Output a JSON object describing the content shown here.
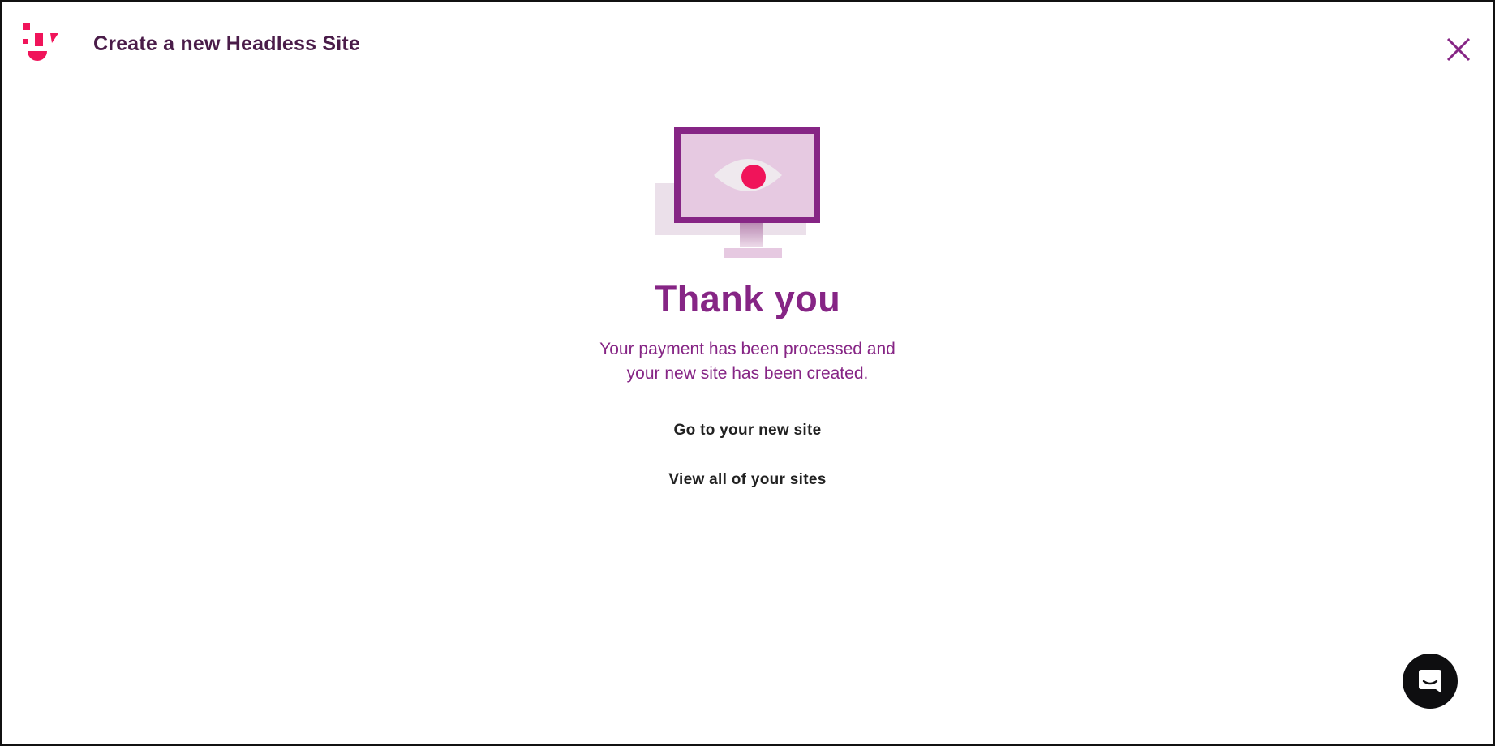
{
  "header": {
    "title": "Create a new Headless Site",
    "logo_icon": "brand-logo-icon",
    "close_icon": "close-icon"
  },
  "main": {
    "illustration_icon": "monitor-eye-icon",
    "heading": "Thank you",
    "message_line1": "Your payment has been processed and",
    "message_line2": "your new site has been created.",
    "links": [
      {
        "label": "Go to your new site"
      },
      {
        "label": "View all of your sites"
      }
    ]
  },
  "chat": {
    "icon": "chat-icon"
  },
  "colors": {
    "brand_pink": "#f0145a",
    "brand_purple": "#862585",
    "title_color": "#4a1c49",
    "monitor_fill": "#e6c9e1",
    "chat_bg": "#0e0e10"
  }
}
